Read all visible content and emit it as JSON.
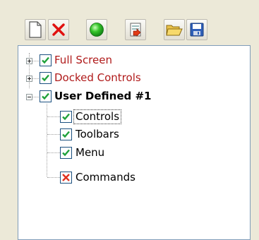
{
  "toolbar": {
    "buttons": [
      {
        "name": "new-button",
        "icon": "new-document-icon"
      },
      {
        "name": "delete-button",
        "icon": "red-x-icon"
      },
      {
        "name": "status-button",
        "icon": "green-circle-icon"
      },
      {
        "name": "export-button",
        "icon": "export-document-icon"
      },
      {
        "name": "open-button",
        "icon": "open-folder-icon"
      },
      {
        "name": "save-button",
        "icon": "floppy-disk-icon"
      }
    ]
  },
  "tree": {
    "items": [
      {
        "label": "Full Screen",
        "checked": true,
        "expanded": false,
        "style": "red"
      },
      {
        "label": "Docked Controls",
        "checked": true,
        "expanded": false,
        "style": "red"
      },
      {
        "label": "User Defined #1",
        "checked": true,
        "expanded": true,
        "style": "bold",
        "children": [
          {
            "label": "Controls",
            "checked": true,
            "selected": true
          },
          {
            "label": "Toolbars",
            "checked": true
          },
          {
            "label": "Menu",
            "checked": true
          },
          {
            "label": "Commands",
            "checked": false,
            "state": "excluded"
          }
        ]
      }
    ]
  },
  "colors": {
    "check_green": "#1fa13a",
    "excluded_red": "#e0301e",
    "label_red": "#b01a1a"
  }
}
